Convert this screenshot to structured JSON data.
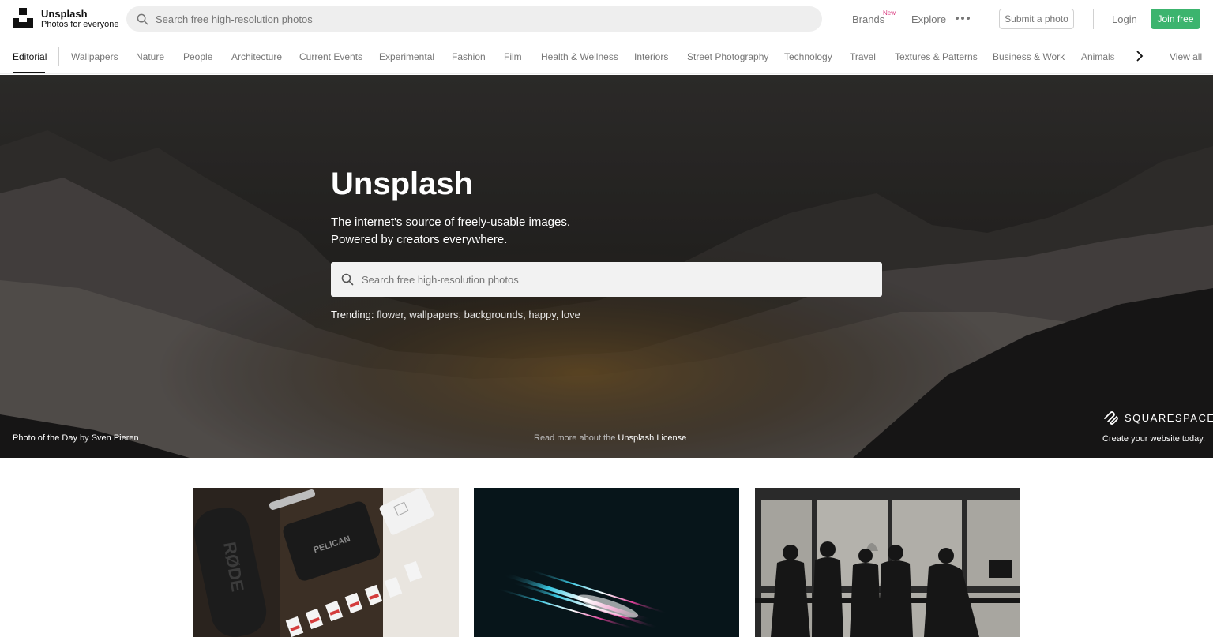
{
  "header": {
    "logo_title": "Unsplash",
    "logo_subtitle": "Photos for everyone",
    "search_placeholder": "Search free high-resolution photos",
    "brands_label": "Brands",
    "brands_badge": "New",
    "explore_label": "Explore",
    "submit_label": "Submit a photo",
    "login_label": "Login",
    "join_label": "Join free"
  },
  "topics": {
    "items": [
      "Editorial",
      "Wallpapers",
      "Nature",
      "People",
      "Architecture",
      "Current Events",
      "Experimental",
      "Fashion",
      "Film",
      "Health & Wellness",
      "Interiors",
      "Street Photography",
      "Technology",
      "Travel",
      "Textures & Patterns",
      "Business & Work",
      "Animals"
    ],
    "active": "Editorial",
    "view_all": "View all"
  },
  "hero": {
    "title": "Unsplash",
    "line1_prefix": "The internet's source of ",
    "line1_link": "freely-usable images",
    "line1_suffix": ".",
    "line2": "Powered by creators everywhere.",
    "search_placeholder": "Search free high-resolution photos",
    "trending_label": "Trending",
    "trending": [
      "flower",
      "wallpapers",
      "backgrounds",
      "happy",
      "love"
    ],
    "potd_label": "Photo of the Day",
    "potd_by": "by",
    "potd_author": "Sven Pieren",
    "license_prefix": "Read more about the",
    "license_link": "Unsplash License",
    "sponsor_name": "SQUARESPACE",
    "sponsor_tagline": "Create your website today."
  },
  "photos": [
    {
      "alt": "RODE PELICAN gear flat lay"
    },
    {
      "alt": "light streaks on dark background"
    },
    {
      "alt": "silhouettes of people by window"
    }
  ],
  "colors": {
    "join_button": "#3cb46e",
    "new_badge": "#d93a7f",
    "muted_text": "#767676"
  }
}
